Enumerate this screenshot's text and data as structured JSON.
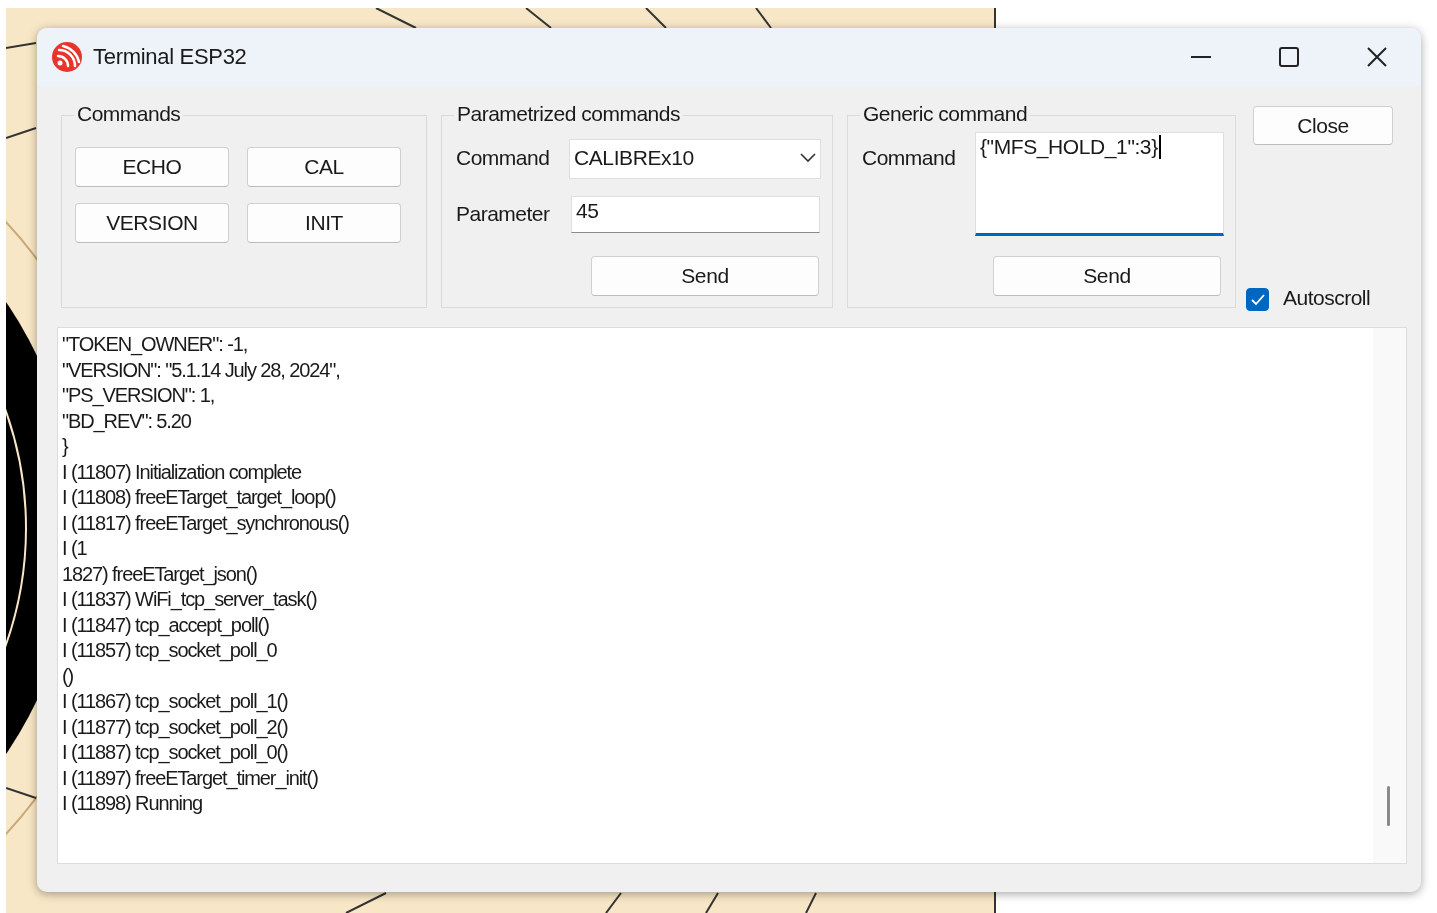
{
  "window": {
    "title": "Terminal ESP32"
  },
  "commands": {
    "title": "Commands",
    "buttons": [
      "ECHO",
      "CAL",
      "VERSION",
      "INIT"
    ]
  },
  "parametrized": {
    "title": "Parametrized commands",
    "command_label": "Command",
    "command_value": "CALIBREx10",
    "parameter_label": "Parameter",
    "parameter_value": "45",
    "send": "Send"
  },
  "generic": {
    "title": "Generic command",
    "command_label": "Command",
    "command_value": "{\"MFS_HOLD_1\":3}",
    "send": "Send"
  },
  "close_button": "Close",
  "autoscroll": {
    "label": "Autoscroll",
    "checked": true
  },
  "log": {
    "lines": [
      "\"TOKEN_OWNER\": -1,",
      "\"VERSION\": \"5.1.14 July 28, 2024\",",
      "\"PS_VERSION\": 1,",
      "\"BD_REV\": 5.20",
      "}",
      "I (11807) Initialization complete",
      "I (11808) freeETarget_target_loop()",
      "I (11817) freeETarget_synchronous()",
      "I (1",
      "1827) freeETarget_json()",
      "I (11837) WiFi_tcp_server_task()",
      "I (11847) tcp_accept_poll()",
      "I (11857) tcp_socket_poll_0",
      "()",
      "I (11867) tcp_socket_poll_1()",
      "I (11877) tcp_socket_poll_2()",
      "I (11887) tcp_socket_poll_0()",
      "I (11897) freeETarget_timer_init()",
      "I (11898) Running"
    ]
  }
}
